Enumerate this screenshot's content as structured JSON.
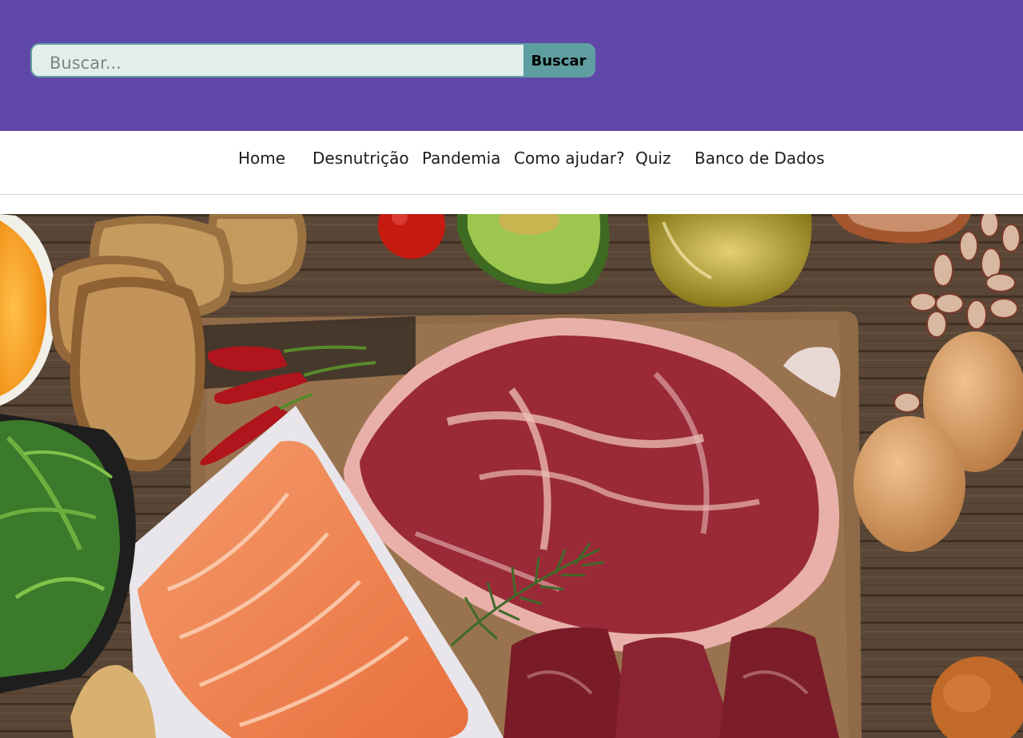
{
  "search": {
    "placeholder": "Buscar...",
    "button_label": "Buscar"
  },
  "nav": {
    "items": [
      {
        "label": "Home"
      },
      {
        "label": "Desnutrição"
      },
      {
        "label": "Pandemia"
      },
      {
        "label": "Como ajudar?"
      },
      {
        "label": "Quiz"
      },
      {
        "label": "Banco de Dados"
      }
    ]
  },
  "colors": {
    "header_bg": "#6048a8",
    "search_accent": "#5f9ea0",
    "search_field_bg": "#e2eeec",
    "nav_text": "#1d1d1d"
  }
}
